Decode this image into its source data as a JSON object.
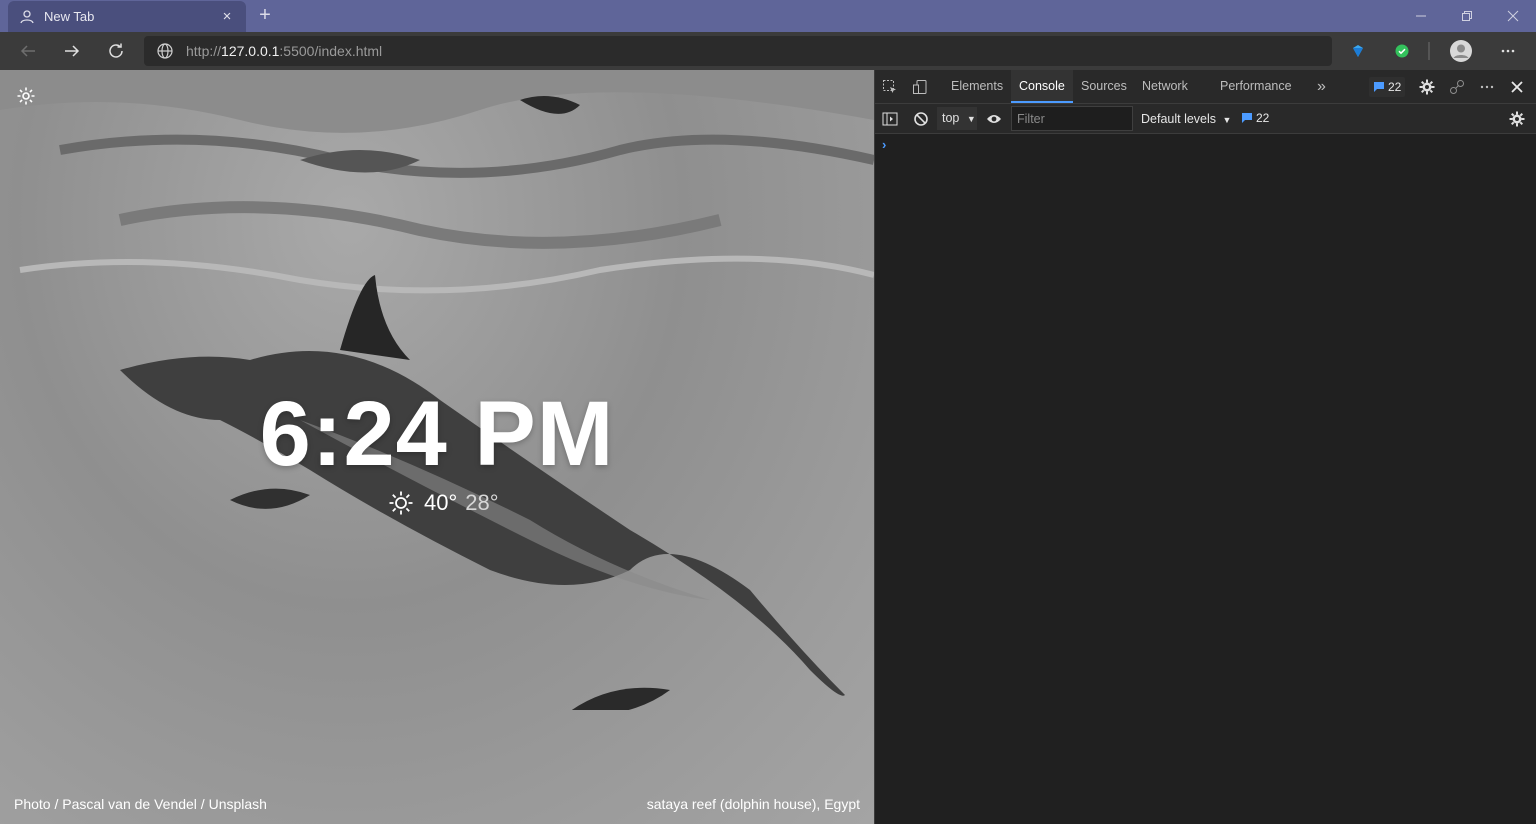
{
  "browser": {
    "tab_title": "New Tab",
    "tab_close": "×",
    "new_tab": "+",
    "url_prefix": "http://",
    "url_host": "127.0.0.1",
    "url_rest": ":5500/index.html"
  },
  "page": {
    "time": "6:24 PM",
    "temp_high": "40°",
    "temp_low": "28°",
    "weather_icon": "sun-icon",
    "credit_left": "Photo / Pascal van de Vendel / Unsplash",
    "credit_right": "sataya reef (dolphin house), Egypt"
  },
  "devtools": {
    "tabs": [
      "Elements",
      "Console",
      "Sources",
      "Network",
      "Performance"
    ],
    "active_tab": "Console",
    "more_tabs": "»",
    "issue_count": "22",
    "context": "top",
    "filter_placeholder": "Filter",
    "levels_label": "Default levels",
    "message_count": "22",
    "prompt": "›"
  },
  "colors": {
    "titlebar": "#5f6599",
    "accent_blue": "#4c9bff",
    "devtools_bg": "#202020"
  }
}
